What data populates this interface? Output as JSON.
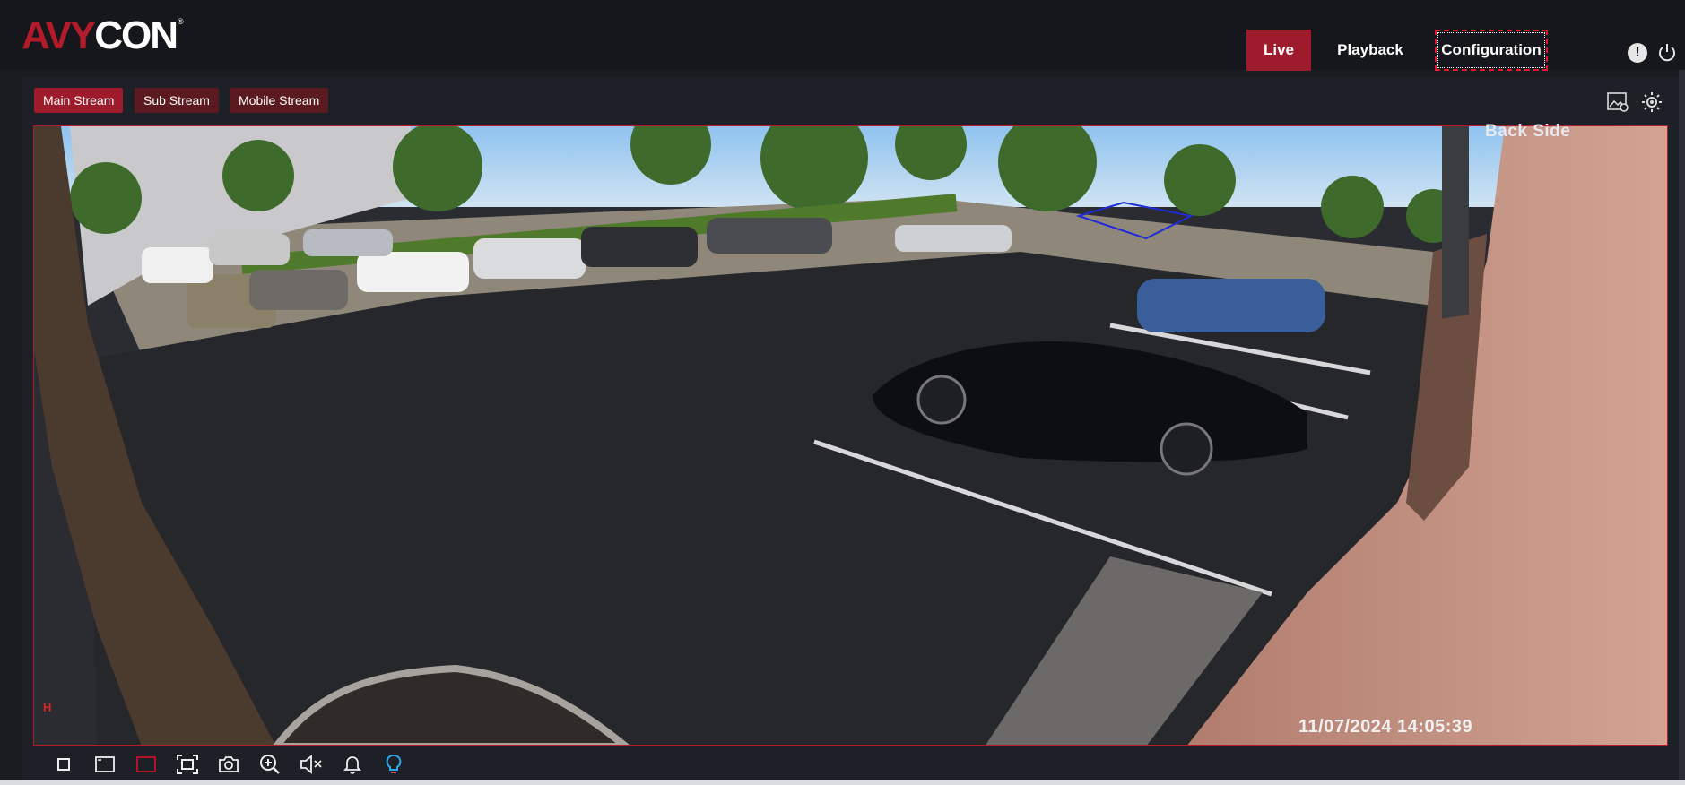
{
  "brand": {
    "logo_text_part1": "AVY",
    "logo_text_part2": "CON",
    "logo_mark": "®"
  },
  "nav": {
    "live": "Live",
    "playback": "Playback",
    "configuration": "Configuration"
  },
  "header_icons": [
    "alert-icon",
    "power-icon"
  ],
  "streams": {
    "main": "Main Stream",
    "sub": "Sub Stream",
    "mobile": "Mobile Stream",
    "selected": "Main Stream"
  },
  "video": {
    "osd_title": "Back Side",
    "osd_timestamp": "11/07/2024 14:05:39",
    "osd_corner": "H"
  },
  "right_tools": [
    "image-settings-icon",
    "brightness-icon"
  ],
  "toolbar": [
    "stop-icon",
    "draw-area-icon",
    "select-area-icon",
    "fullscreen-icon",
    "snapshot-icon",
    "zoom-in-icon",
    "mute-icon",
    "alarm-bell-icon",
    "light-bulb-icon"
  ],
  "colors": {
    "accent": "#9e1b2c",
    "stream_inactive": "#5a1a1f",
    "background": "#15171c",
    "bulb": "#2fa7e8"
  }
}
